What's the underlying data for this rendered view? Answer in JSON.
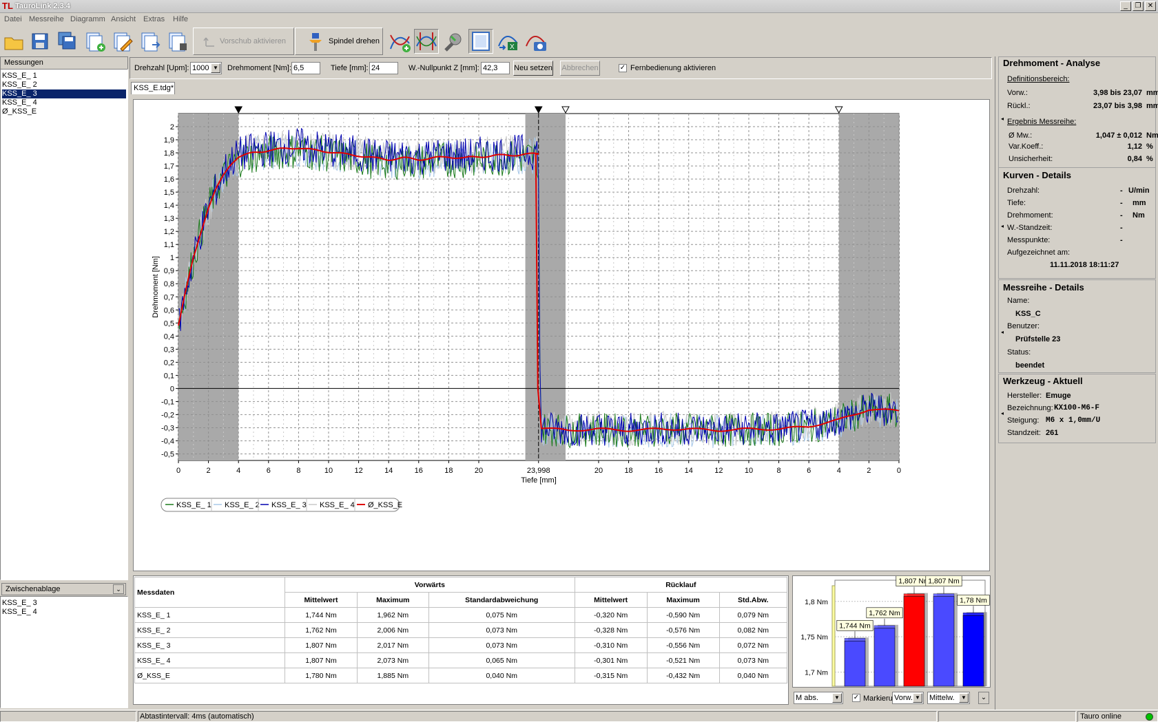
{
  "app": {
    "title": "TauroLink 2.3.4"
  },
  "menu": [
    "Datei",
    "Messreihe",
    "Diagramm",
    "Ansicht",
    "Extras",
    "Hilfe"
  ],
  "toolbar": {
    "feed_label": "Vorschub aktivieren",
    "spindle_label": "Spindel drehen"
  },
  "params": {
    "speed_label": "Drehzahl [Upm]:",
    "speed_value": "1000",
    "torque_label": "Drehmoment [Nm]:",
    "torque_value": "6,5",
    "depth_label": "Tiefe [mm]:",
    "depth_value": "24",
    "zero_label": "W.-Nullpunkt Z [mm]:",
    "zero_value": "42,3",
    "reset_label": "Neu setzen",
    "cancel_label": "Abbrechen",
    "remote_label": "Fernbedienung aktivieren"
  },
  "measurements": {
    "title": "Messungen",
    "items": [
      "KSS_E_ 1",
      "KSS_E_ 2",
      "KSS_E_ 3",
      "KSS_E_ 4",
      "Ø_KSS_E"
    ],
    "selected": 2
  },
  "clipboard": {
    "title": "Zwischenablage",
    "items": [
      "KSS_E_ 3",
      "KSS_E_ 4"
    ]
  },
  "doc_tab": "KSS_E.tdg*",
  "chart_data": {
    "type": "line",
    "ylabel": "Drehmoment [Nm]",
    "xlabel": "Tiefe [mm]",
    "ylim": [
      -0.55,
      2.1
    ],
    "y_ticks": [
      "2",
      "1,9",
      "1,8",
      "1,7",
      "1,6",
      "1,5",
      "1,4",
      "1,3",
      "1,2",
      "1,1",
      "1",
      "0,9",
      "0,8",
      "0,7",
      "0,6",
      "0,5",
      "0,4",
      "0,3",
      "0,2",
      "0,1",
      "0",
      "-0,1",
      "-0,2",
      "-0,3",
      "-0,4",
      "-0,5"
    ],
    "x_ticks": [
      "0",
      "2",
      "4",
      "6",
      "8",
      "10",
      "12",
      "14",
      "16",
      "18",
      "20",
      "23,998",
      "20",
      "18",
      "16",
      "14",
      "12",
      "10",
      "8",
      "6",
      "4",
      "2",
      "0"
    ],
    "x_ticks_forward": [
      0,
      2,
      4,
      6,
      8,
      10,
      12,
      14,
      16,
      18,
      20
    ],
    "x_ticks_reverse": [
      20,
      18,
      16,
      14,
      12,
      10,
      8,
      6,
      4,
      2,
      0
    ],
    "turn_point": 23.998,
    "grid": true,
    "legend_position": "bottom-left",
    "series": [
      {
        "name": "KSS_E_ 1",
        "color": "#1a7a1a",
        "forward_mean": 1.744,
        "reverse_mean": -0.32
      },
      {
        "name": "KSS_E_ 2",
        "color": "#a8c8e8",
        "forward_mean": 1.762,
        "reverse_mean": -0.328
      },
      {
        "name": "KSS_E_ 3",
        "color": "#0000b0",
        "forward_mean": 1.807,
        "reverse_mean": -0.31
      },
      {
        "name": "KSS_E_ 4",
        "color": "#c8c8c8",
        "forward_mean": 1.807,
        "reverse_mean": -0.301
      },
      {
        "name": "Ø_KSS_E",
        "color": "#e00000",
        "forward_mean": 1.78,
        "reverse_mean": -0.315
      }
    ],
    "mean_curve": {
      "forward_x": [
        0,
        0.5,
        1,
        1.5,
        2,
        2.5,
        3,
        3.5,
        4,
        5,
        6,
        7,
        8,
        9,
        10,
        11,
        12,
        13,
        14,
        15,
        16,
        17,
        18,
        19,
        20,
        21,
        22,
        23,
        24
      ],
      "forward_y": [
        0.48,
        0.75,
        1.0,
        1.2,
        1.38,
        1.52,
        1.63,
        1.72,
        1.77,
        1.8,
        1.82,
        1.83,
        1.84,
        1.82,
        1.81,
        1.79,
        1.78,
        1.76,
        1.75,
        1.76,
        1.75,
        1.76,
        1.77,
        1.76,
        1.77,
        1.78,
        1.78,
        1.79,
        1.79
      ],
      "reverse_x": [
        24,
        22,
        20,
        18,
        16,
        14,
        12,
        10,
        8,
        6,
        4,
        2,
        0
      ],
      "reverse_y": [
        -0.3,
        -0.32,
        -0.31,
        -0.32,
        -0.31,
        -0.31,
        -0.32,
        -0.31,
        -0.31,
        -0.29,
        -0.24,
        -0.16,
        -0.17
      ]
    },
    "markers": {
      "filled": [
        "4",
        "23,998"
      ],
      "hollow": [
        "20",
        "4"
      ]
    }
  },
  "bar_chart": {
    "type": "bar",
    "categories": [
      "KSS_E_ 1",
      "KSS_E_ 2",
      "KSS_E_ 3",
      "KSS_E_ 4",
      "Ø_KSS_E"
    ],
    "values": [
      1.744,
      1.762,
      1.807,
      1.807,
      1.78
    ],
    "labels": [
      "1,744 Nm",
      "1,762 Nm",
      "1,807 Nm",
      "1,807 Nm",
      "1,78 Nm"
    ],
    "colors": [
      "#4a4aff",
      "#4a4aff",
      "#ff0000",
      "#4a4aff",
      "#0000ff"
    ],
    "ylim": [
      1.68,
      1.83
    ],
    "y_ticks": [
      "1,8 Nm",
      "1,75 Nm",
      "1,7 Nm"
    ],
    "mode_select": "M abs.",
    "mark_label": "Markieru",
    "dir_select": "Vorw.",
    "stat_select": "Mittelw."
  },
  "table": {
    "title": "Messdaten",
    "group_forward": "Vorwärts",
    "group_reverse": "Rücklauf",
    "headers": [
      "Mittelwert",
      "Maximum",
      "Standardabweichung",
      "Mittelwert",
      "Maximum",
      "Std.Abw."
    ],
    "rows": [
      {
        "name": "KSS_E_ 1",
        "vals": [
          "1,744 Nm",
          "1,962 Nm",
          "0,075 Nm",
          "-0,320 Nm",
          "-0,590 Nm",
          "0,079 Nm"
        ]
      },
      {
        "name": "KSS_E_ 2",
        "vals": [
          "1,762 Nm",
          "2,006 Nm",
          "0,073 Nm",
          "-0,328 Nm",
          "-0,576 Nm",
          "0,082 Nm"
        ]
      },
      {
        "name": "KSS_E_ 3",
        "vals": [
          "1,807 Nm",
          "2,017 Nm",
          "0,073 Nm",
          "-0,310 Nm",
          "-0,556 Nm",
          "0,072 Nm"
        ]
      },
      {
        "name": "KSS_E_ 4",
        "vals": [
          "1,807 Nm",
          "2,073 Nm",
          "0,065 Nm",
          "-0,301 Nm",
          "-0,521 Nm",
          "0,073 Nm"
        ]
      },
      {
        "name": "Ø_KSS_E",
        "vals": [
          "1,780 Nm",
          "1,885 Nm",
          "0,040 Nm",
          "-0,315 Nm",
          "-0,432 Nm",
          "0,040 Nm"
        ]
      }
    ]
  },
  "analysis": {
    "title": "Drehmoment - Analyse",
    "def_label": "Definitionsbereich:",
    "forward_label": "Vorw.:",
    "forward_value": "3,98 bis 23,07",
    "forward_unit": "mm",
    "reverse_label": "Rückl.:",
    "reverse_value": "23,07 bis 3,98",
    "reverse_unit": "mm",
    "result_label": "Ergebnis Messreihe:",
    "mean_label": "Ø Mw.:",
    "mean_value": "1,047 ± 0,012",
    "mean_unit": "Nm",
    "var_label": "Var.Koeff.:",
    "var_value": "1,12",
    "var_unit": "%",
    "unc_label": "Unsicherheit:",
    "unc_value": "0,84",
    "unc_unit": "%"
  },
  "curves": {
    "title": "Kurven - Details",
    "rows": [
      {
        "label": "Drehzahl:",
        "value": "-",
        "unit": "U/min"
      },
      {
        "label": "Tiefe:",
        "value": "-",
        "unit": "mm"
      },
      {
        "label": "Drehmoment:",
        "value": "-",
        "unit": "Nm"
      },
      {
        "label": "W.-Standzeit:",
        "value": "-",
        "unit": ""
      },
      {
        "label": "Messpunkte:",
        "value": "-",
        "unit": ""
      }
    ],
    "recorded_label": "Aufgezeichnet am:",
    "recorded_value": "11.11.2018 18:11:27"
  },
  "series_details": {
    "title": "Messreihe - Details",
    "name_label": "Name:",
    "name_value": "KSS_C",
    "user_label": "Benutzer:",
    "user_value": "Prüfstelle 23",
    "status_label": "Status:",
    "status_value": "beendet"
  },
  "tool": {
    "title": "Werkzeug - Aktuell",
    "maker_label": "Hersteller:",
    "maker_value": "Emuge",
    "desc_label": "Bezeichnung:",
    "desc_value": "KX100-M6-F",
    "pitch_label": "Steigung:",
    "pitch_value": "M6 x 1,0mm/U",
    "life_label": "Standzeit:",
    "life_value": "261"
  },
  "status": {
    "interval": "Abtastintervall: 4ms (automatisch)",
    "online": "Tauro online",
    "online_color": "#00c000"
  }
}
